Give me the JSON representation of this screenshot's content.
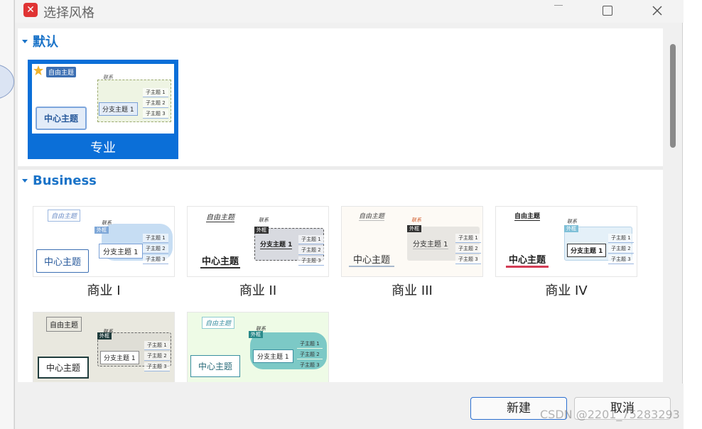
{
  "window": {
    "title": "选择风格",
    "app_logo": "xmind-logo",
    "controls": [
      "minimize-icon",
      "maximize-icon",
      "close-icon"
    ]
  },
  "sections": [
    {
      "title": "默认",
      "styles": [
        {
          "label": "专业",
          "selected": true
        }
      ]
    },
    {
      "title": "Business",
      "styles": [
        {
          "label": "商业 I"
        },
        {
          "label": "商业 II"
        },
        {
          "label": "商业 III"
        },
        {
          "label": "商业 IV"
        },
        {
          "label": ""
        },
        {
          "label": ""
        }
      ]
    }
  ],
  "preview_text": {
    "central": "中心主题",
    "branch": "分支主题 1",
    "floating": "自由主题",
    "relationship": "联系",
    "summary": "外框",
    "subtopics": [
      "子主题 1",
      "子主题 2",
      "子主题 3"
    ]
  },
  "buttons": {
    "create": "新建",
    "cancel": "取消"
  },
  "watermark": "CSDN @2201_75283293",
  "colors": {
    "accent": "#1a73c8",
    "selected_bg": "#0b6fd8",
    "logo": "#e03434"
  }
}
